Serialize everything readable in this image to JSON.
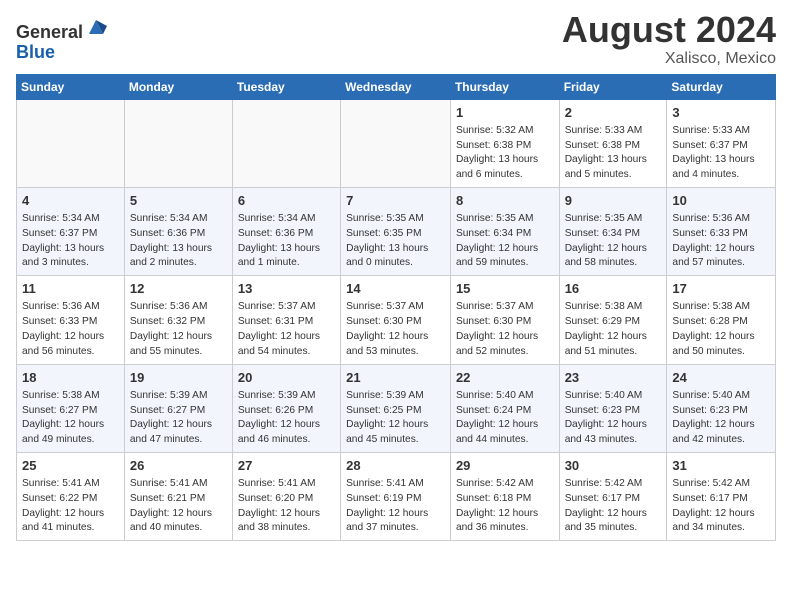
{
  "header": {
    "logo_general": "General",
    "logo_blue": "Blue",
    "month_year": "August 2024",
    "location": "Xalisco, Mexico"
  },
  "weekdays": [
    "Sunday",
    "Monday",
    "Tuesday",
    "Wednesday",
    "Thursday",
    "Friday",
    "Saturday"
  ],
  "weeks": [
    [
      {
        "day": "",
        "info": ""
      },
      {
        "day": "",
        "info": ""
      },
      {
        "day": "",
        "info": ""
      },
      {
        "day": "",
        "info": ""
      },
      {
        "day": "1",
        "info": "Sunrise: 5:32 AM\nSunset: 6:38 PM\nDaylight: 13 hours\nand 6 minutes."
      },
      {
        "day": "2",
        "info": "Sunrise: 5:33 AM\nSunset: 6:38 PM\nDaylight: 13 hours\nand 5 minutes."
      },
      {
        "day": "3",
        "info": "Sunrise: 5:33 AM\nSunset: 6:37 PM\nDaylight: 13 hours\nand 4 minutes."
      }
    ],
    [
      {
        "day": "4",
        "info": "Sunrise: 5:34 AM\nSunset: 6:37 PM\nDaylight: 13 hours\nand 3 minutes."
      },
      {
        "day": "5",
        "info": "Sunrise: 5:34 AM\nSunset: 6:36 PM\nDaylight: 13 hours\nand 2 minutes."
      },
      {
        "day": "6",
        "info": "Sunrise: 5:34 AM\nSunset: 6:36 PM\nDaylight: 13 hours\nand 1 minute."
      },
      {
        "day": "7",
        "info": "Sunrise: 5:35 AM\nSunset: 6:35 PM\nDaylight: 13 hours\nand 0 minutes."
      },
      {
        "day": "8",
        "info": "Sunrise: 5:35 AM\nSunset: 6:34 PM\nDaylight: 12 hours\nand 59 minutes."
      },
      {
        "day": "9",
        "info": "Sunrise: 5:35 AM\nSunset: 6:34 PM\nDaylight: 12 hours\nand 58 minutes."
      },
      {
        "day": "10",
        "info": "Sunrise: 5:36 AM\nSunset: 6:33 PM\nDaylight: 12 hours\nand 57 minutes."
      }
    ],
    [
      {
        "day": "11",
        "info": "Sunrise: 5:36 AM\nSunset: 6:33 PM\nDaylight: 12 hours\nand 56 minutes."
      },
      {
        "day": "12",
        "info": "Sunrise: 5:36 AM\nSunset: 6:32 PM\nDaylight: 12 hours\nand 55 minutes."
      },
      {
        "day": "13",
        "info": "Sunrise: 5:37 AM\nSunset: 6:31 PM\nDaylight: 12 hours\nand 54 minutes."
      },
      {
        "day": "14",
        "info": "Sunrise: 5:37 AM\nSunset: 6:30 PM\nDaylight: 12 hours\nand 53 minutes."
      },
      {
        "day": "15",
        "info": "Sunrise: 5:37 AM\nSunset: 6:30 PM\nDaylight: 12 hours\nand 52 minutes."
      },
      {
        "day": "16",
        "info": "Sunrise: 5:38 AM\nSunset: 6:29 PM\nDaylight: 12 hours\nand 51 minutes."
      },
      {
        "day": "17",
        "info": "Sunrise: 5:38 AM\nSunset: 6:28 PM\nDaylight: 12 hours\nand 50 minutes."
      }
    ],
    [
      {
        "day": "18",
        "info": "Sunrise: 5:38 AM\nSunset: 6:27 PM\nDaylight: 12 hours\nand 49 minutes."
      },
      {
        "day": "19",
        "info": "Sunrise: 5:39 AM\nSunset: 6:27 PM\nDaylight: 12 hours\nand 47 minutes."
      },
      {
        "day": "20",
        "info": "Sunrise: 5:39 AM\nSunset: 6:26 PM\nDaylight: 12 hours\nand 46 minutes."
      },
      {
        "day": "21",
        "info": "Sunrise: 5:39 AM\nSunset: 6:25 PM\nDaylight: 12 hours\nand 45 minutes."
      },
      {
        "day": "22",
        "info": "Sunrise: 5:40 AM\nSunset: 6:24 PM\nDaylight: 12 hours\nand 44 minutes."
      },
      {
        "day": "23",
        "info": "Sunrise: 5:40 AM\nSunset: 6:23 PM\nDaylight: 12 hours\nand 43 minutes."
      },
      {
        "day": "24",
        "info": "Sunrise: 5:40 AM\nSunset: 6:23 PM\nDaylight: 12 hours\nand 42 minutes."
      }
    ],
    [
      {
        "day": "25",
        "info": "Sunrise: 5:41 AM\nSunset: 6:22 PM\nDaylight: 12 hours\nand 41 minutes."
      },
      {
        "day": "26",
        "info": "Sunrise: 5:41 AM\nSunset: 6:21 PM\nDaylight: 12 hours\nand 40 minutes."
      },
      {
        "day": "27",
        "info": "Sunrise: 5:41 AM\nSunset: 6:20 PM\nDaylight: 12 hours\nand 38 minutes."
      },
      {
        "day": "28",
        "info": "Sunrise: 5:41 AM\nSunset: 6:19 PM\nDaylight: 12 hours\nand 37 minutes."
      },
      {
        "day": "29",
        "info": "Sunrise: 5:42 AM\nSunset: 6:18 PM\nDaylight: 12 hours\nand 36 minutes."
      },
      {
        "day": "30",
        "info": "Sunrise: 5:42 AM\nSunset: 6:17 PM\nDaylight: 12 hours\nand 35 minutes."
      },
      {
        "day": "31",
        "info": "Sunrise: 5:42 AM\nSunset: 6:17 PM\nDaylight: 12 hours\nand 34 minutes."
      }
    ]
  ]
}
